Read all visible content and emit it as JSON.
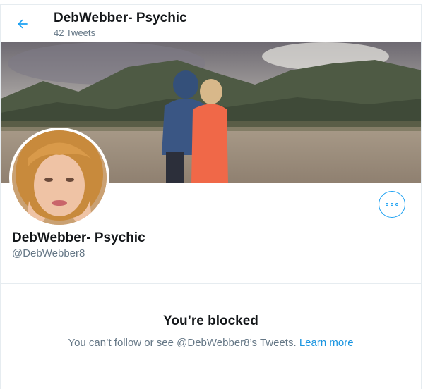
{
  "header": {
    "title": "DebWebber- Psychic",
    "tweet_count": "42 Tweets"
  },
  "profile": {
    "display_name": "DebWebber- Psychic",
    "handle": "@DebWebber8"
  },
  "blocked": {
    "title": "You’re blocked",
    "message": "You can’t follow or see @DebWebber8’s Tweets.",
    "learn_more": "Learn more"
  },
  "colors": {
    "accent": "#1da1f2",
    "secondary_text": "#657786",
    "primary_text": "#14171a",
    "border": "#e6ecf0"
  },
  "icons": {
    "back": "arrow-left-icon",
    "more": "more-dots-icon"
  }
}
